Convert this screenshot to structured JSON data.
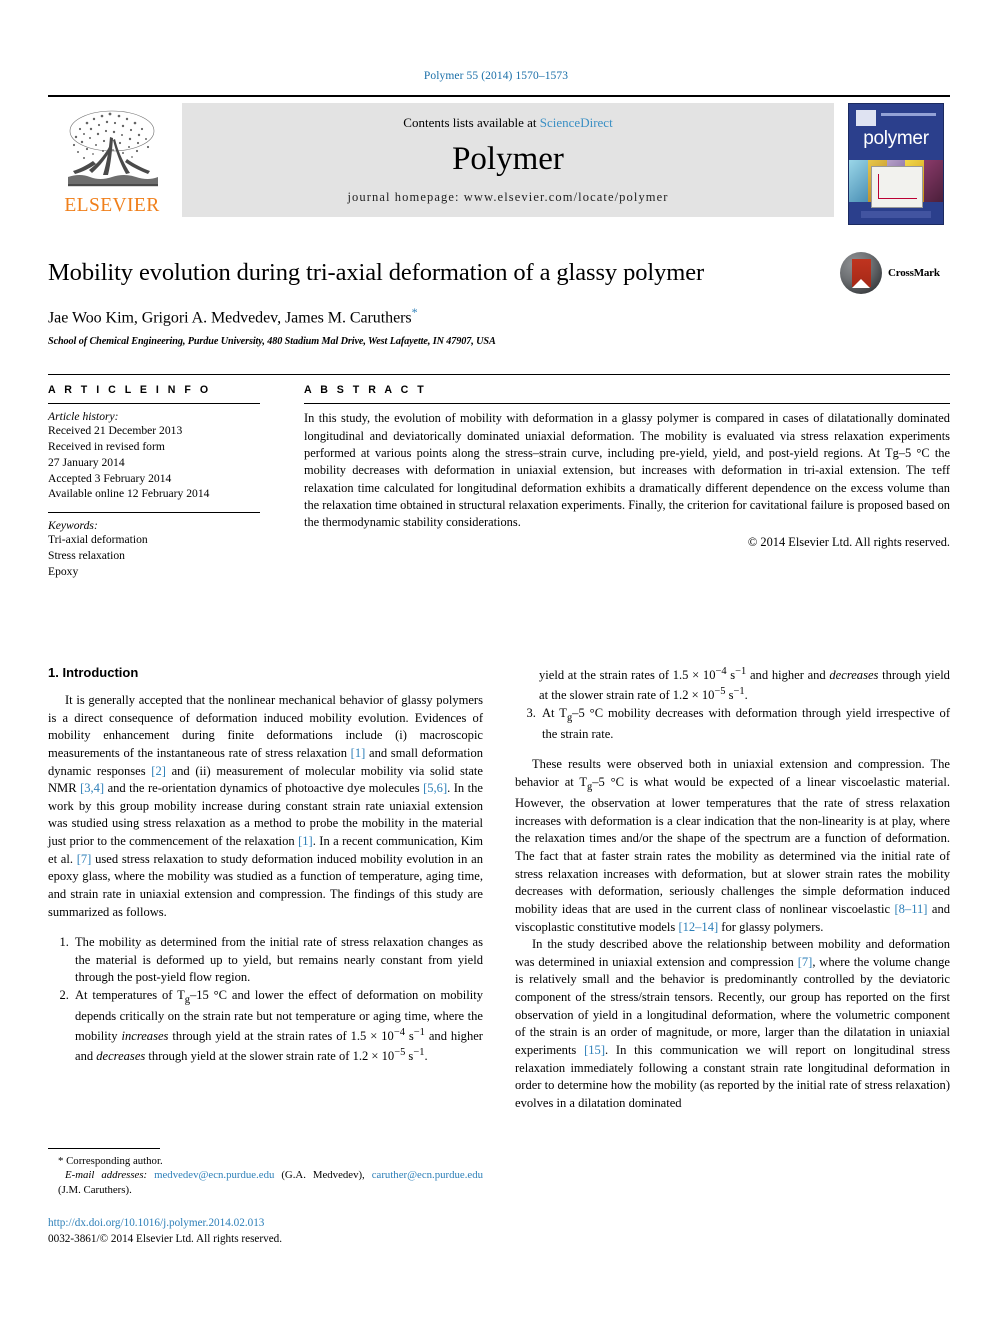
{
  "running_head": "Polymer 55 (2014) 1570–1573",
  "masthead": {
    "publisher": "ELSEVIER",
    "contents_prefix": "Contents lists available at ",
    "contents_link": "ScienceDirect",
    "journal_name": "Polymer",
    "homepage": "journal homepage: www.elsevier.com/locate/polymer",
    "cover_title": "polymer"
  },
  "title_block": {
    "title": "Mobility evolution during tri-axial deformation of a glassy polymer",
    "authors": "Jae Woo Kim, Grigori A. Medvedev, James M. Caruthers",
    "corresponding_marker": "*",
    "affiliation": "School of Chemical Engineering, Purdue University, 480 Stadium Mal Drive, West Lafayette, IN 47907, USA",
    "crossmark_label": "CrossMark"
  },
  "article_info": {
    "heading": "A R T I C L E  I N F O",
    "history_label": "Article history:",
    "history": [
      "Received 21 December 2013",
      "Received in revised form",
      "27 January 2014",
      "Accepted 3 February 2014",
      "Available online 12 February 2014"
    ],
    "keywords_label": "Keywords:",
    "keywords": [
      "Tri-axial deformation",
      "Stress relaxation",
      "Epoxy"
    ]
  },
  "abstract": {
    "heading": "A B S T R A C T",
    "text": "In this study, the evolution of mobility with deformation in a glassy polymer is compared in cases of dilatationally dominated longitudinal and deviatorically dominated uniaxial deformation. The mobility is evaluated via stress relaxation experiments performed at various points along the stress–strain curve, including pre-yield, yield, and post-yield regions. At Tg–5 °C the mobility decreases with deformation in uniaxial extension, but increases with deformation in tri-axial extension. The τeff relaxation time calculated for longitudinal deformation exhibits a dramatically different dependence on the excess volume than the relaxation time obtained in structural relaxation experiments. Finally, the criterion for cavitational failure is proposed based on the thermodynamic stability considerations.",
    "copyright": "© 2014 Elsevier Ltd. All rights reserved."
  },
  "body": {
    "section_title": "1. Introduction",
    "para1_a": "It is generally accepted that the nonlinear mechanical behavior of glassy polymers is a direct consequence of deformation induced mobility evolution. Evidences of mobility enhancement during finite deformations include (i) macroscopic measurements of the instantaneous rate of stress relaxation ",
    "ref1": "[1]",
    "para1_b": " and small deformation dynamic responses ",
    "ref2": "[2]",
    "para1_c": " and (ii) measurement of molecular mobility via solid state NMR ",
    "ref34": "[3,4]",
    "para1_d": " and the re-orientation dynamics of photoactive dye molecules ",
    "ref56": "[5,6]",
    "para1_e": ". In the work by this group mobility increase during constant strain rate uniaxial extension was studied using stress relaxation as a method to probe the mobility in the material just prior to the commencement of the relaxation ",
    "ref1b": "[1]",
    "para1_f": ". In a recent communication, Kim et al. ",
    "ref7": "[7]",
    "para1_g": " used stress relaxation to study deformation induced mobility evolution in an epoxy glass, where the mobility was studied as a function of temperature, aging time, and strain rate in uniaxial extension and compression. The findings of this study are summarized as follows.",
    "finding1": "The mobility as determined from the initial rate of stress relaxation changes as the material is deformed up to yield, but remains nearly constant from yield through the post-yield flow region.",
    "finding2_a": "At temperatures of T",
    "finding2_sub": "g",
    "finding2_b": "–15 °C and lower the effect of deformation on mobility depends critically on the strain rate but not temperature or aging time, where the mobility ",
    "finding2_em1": "increases",
    "finding2_c": " through yield at the strain rates of 1.5 × 10",
    "finding2_sup1": "−4",
    "finding2_d": " s",
    "finding2_sup2": "−1",
    "finding2_e": " and higher and ",
    "finding2_em2": "decreases",
    "finding2_f": " through yield at the slower strain rate of 1.2 × 10",
    "finding2_sup3": "−5",
    "finding2_g": " s",
    "finding2_sup4": "−1",
    "finding2_h": ".",
    "finding3_a": "At T",
    "finding3_sub": "g",
    "finding3_b": "–5 °C mobility decreases with deformation through yield irrespective of the strain rate.",
    "para2_a": "These results were observed both in uniaxial extension and compression. The behavior at T",
    "para2_sub": "g",
    "para2_b": "–5 °C is what would be expected of a linear viscoelastic material. However, the observation at lower temperatures that the rate of stress relaxation increases with deformation is a clear indication that the non-linearity is at play, where the relaxation times and/or the shape of the spectrum are a function of deformation. The fact that at faster strain rates the mobility as determined via the initial rate of stress relaxation increases with deformation, but at slower strain rates the mobility decreases with deformation, seriously challenges the simple deformation induced mobility ideas that are used in the current class of nonlinear viscoelastic ",
    "ref811": "[8–11]",
    "para2_c": " and viscoplastic constitutive models ",
    "ref1214": "[12–14]",
    "para2_d": " for glassy polymers.",
    "para3_a": "In the study described above the relationship between mobility and deformation was determined in uniaxial extension and compression ",
    "ref7b": "[7]",
    "para3_b": ", where the volume change is relatively small and the behavior is predominantly controlled by the deviatoric component of the stress/strain tensors. Recently, our group has reported on the first observation of yield in a longitudinal deformation, where the volumetric component of the strain is an order of magnitude, or more, larger than the dilatation in uniaxial experiments ",
    "ref15": "[15]",
    "para3_c": ". In this communication we will report on longitudinal stress relaxation immediately following a constant strain rate longitudinal deformation in order to determine how the mobility (as reported by the initial rate of stress relaxation) evolves in a dilatation dominated"
  },
  "footnote": {
    "corresponding": "* Corresponding author.",
    "email_label": "E-mail addresses:",
    "email1": "medvedev@ecn.purdue.edu",
    "email1_name": " (G.A. Medvedev), ",
    "email2": "caruther@ecn.purdue.edu",
    "email2_name": " (J.M. Caruthers).",
    "doi": "http://dx.doi.org/10.1016/j.polymer.2014.02.013",
    "issn": "0032-3861/© 2014 Elsevier Ltd. All rights reserved."
  },
  "colors": {
    "link_blue": "#2d7fb8",
    "sciencedirect_blue": "#3a8fc4",
    "elsevier_orange": "#f07f1a",
    "cover_blue": "#2b3f8c"
  }
}
